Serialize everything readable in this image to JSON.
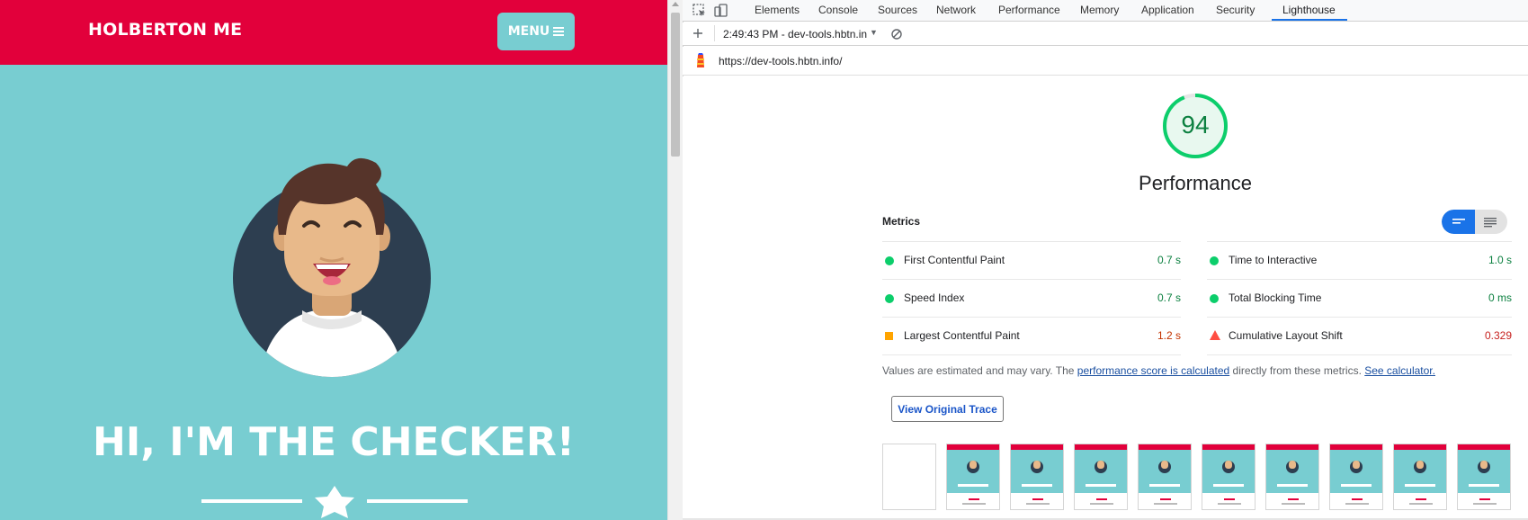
{
  "website": {
    "brand": "HOLBERTON ME",
    "menu_label": "MENU",
    "headline": "HI, I'M THE CHECKER!",
    "colors": {
      "header": "#e2003b",
      "background": "#78cdd1"
    }
  },
  "devtools": {
    "tabs": [
      "Elements",
      "Console",
      "Sources",
      "Network",
      "Performance",
      "Memory",
      "Application",
      "Security",
      "Lighthouse"
    ],
    "active_tab": "Lighthouse",
    "toolbar": {
      "report_select": "2:49:43 PM - dev-tools.hbtn.in"
    },
    "url": "https://dev-tools.hbtn.info/",
    "report": {
      "score": "94",
      "score_fraction": 0.94,
      "category": "Performance",
      "metrics_title": "Metrics",
      "metrics": [
        {
          "name": "First Contentful Paint",
          "value": "0.7 s",
          "status": "pass"
        },
        {
          "name": "Time to Interactive",
          "value": "1.0 s",
          "status": "pass"
        },
        {
          "name": "Speed Index",
          "value": "0.7 s",
          "status": "pass"
        },
        {
          "name": "Total Blocking Time",
          "value": "0 ms",
          "status": "pass"
        },
        {
          "name": "Largest Contentful Paint",
          "value": "1.2 s",
          "status": "average"
        },
        {
          "name": "Cumulative Layout Shift",
          "value": "0.329",
          "status": "fail"
        }
      ],
      "note": {
        "prefix": "Values are estimated and may vary. The ",
        "link1": "performance score is calculated",
        "middle": " directly from these metrics. ",
        "link2": "See calculator."
      },
      "trace_button": "View Original Trace",
      "filmstrip_frame_count": 10
    },
    "status_colors": {
      "pass": "#0cce6b",
      "average": "#ffa400",
      "fail": "#ff4e42"
    },
    "value_colors": {
      "pass": "#0c8040",
      "average": "#c33300",
      "fail": "#c7221f"
    }
  }
}
